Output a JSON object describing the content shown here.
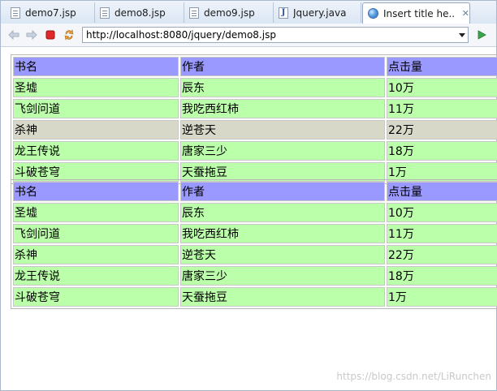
{
  "tabs": [
    {
      "label": "demo7.jsp",
      "icon": "jsp-file-icon",
      "active": false
    },
    {
      "label": "demo8.jsp",
      "icon": "jsp-file-icon",
      "active": false
    },
    {
      "label": "demo9.jsp",
      "icon": "jsp-file-icon",
      "active": false
    },
    {
      "label": "Jquery.java",
      "icon": "java-file-icon",
      "active": false
    },
    {
      "label": "Insert title he...",
      "icon": "globe-icon",
      "active": true,
      "close": "✕"
    }
  ],
  "toolbar": {
    "back_icon": "back-arrow-icon",
    "forward_icon": "forward-arrow-icon",
    "stop_icon": "stop-icon",
    "refresh_icon": "refresh-icon",
    "url": "http://localhost:8080/jquery/demo8.jsp",
    "go_icon": "go-play-icon"
  },
  "colors": {
    "header_row": "#9999ff",
    "data_row": "#bbffaa",
    "hover_row": "#d8d8c8"
  },
  "tables": [
    {
      "headers": [
        "书名",
        "作者",
        "点击量"
      ],
      "rows": [
        {
          "cells": [
            "圣墟",
            "辰东",
            "10万"
          ],
          "highlight": false
        },
        {
          "cells": [
            "飞剑问道",
            "我吃西红柿",
            "11万"
          ],
          "highlight": false
        },
        {
          "cells": [
            "杀神",
            "逆苍天",
            "22万"
          ],
          "highlight": true
        },
        {
          "cells": [
            "龙王传说",
            "唐家三少",
            "18万"
          ],
          "highlight": false
        },
        {
          "cells": [
            "斗破苍穹",
            "天蚕拖豆",
            "1万"
          ],
          "highlight": false
        }
      ]
    },
    {
      "headers": [
        "书名",
        "作者",
        "点击量"
      ],
      "rows": [
        {
          "cells": [
            "圣墟",
            "辰东",
            "10万"
          ],
          "highlight": false
        },
        {
          "cells": [
            "飞剑问道",
            "我吃西红柿",
            "11万"
          ],
          "highlight": false
        },
        {
          "cells": [
            "杀神",
            "逆苍天",
            "22万"
          ],
          "highlight": false
        },
        {
          "cells": [
            "龙王传说",
            "唐家三少",
            "18万"
          ],
          "highlight": false
        },
        {
          "cells": [
            "斗破苍穹",
            "天蚕拖豆",
            "1万"
          ],
          "highlight": false
        }
      ]
    }
  ],
  "watermark": "https://blog.csdn.net/LiRunchen"
}
